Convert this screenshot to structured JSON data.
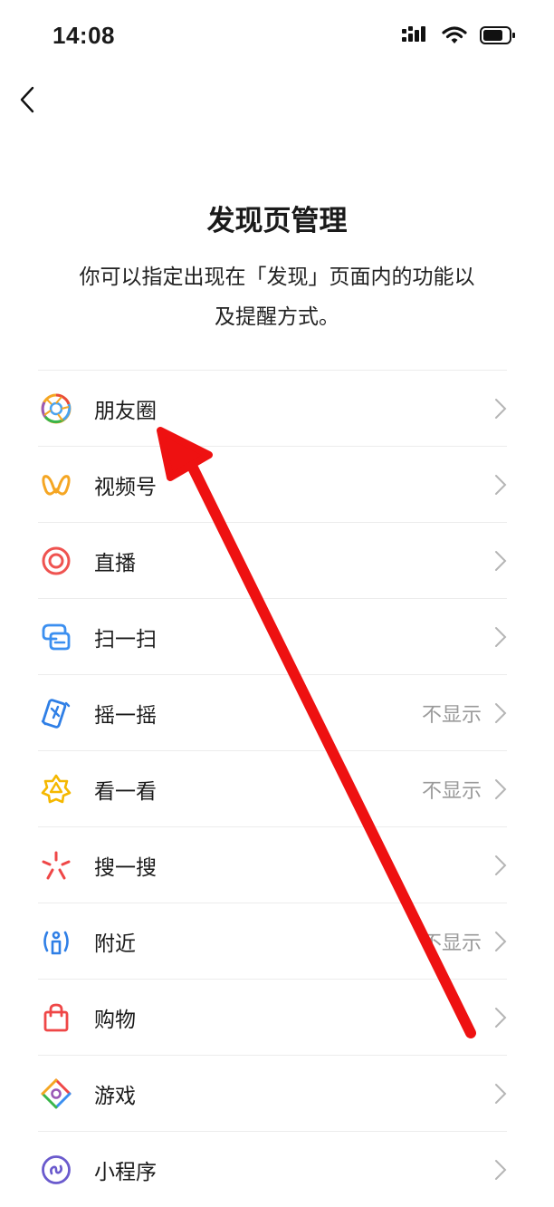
{
  "status_bar": {
    "time": "14:08"
  },
  "header": {
    "title": "发现页管理",
    "description_line1": "你可以指定出现在「发现」页面内的功能以",
    "description_line2": "及提醒方式。"
  },
  "items": [
    {
      "label": "朋友圈",
      "icon": "moments-icon",
      "status": ""
    },
    {
      "label": "视频号",
      "icon": "channels-icon",
      "status": ""
    },
    {
      "label": "直播",
      "icon": "live-icon",
      "status": ""
    },
    {
      "label": "扫一扫",
      "icon": "scan-icon",
      "status": ""
    },
    {
      "label": "摇一摇",
      "icon": "shake-icon",
      "status": "不显示"
    },
    {
      "label": "看一看",
      "icon": "top-stories-icon",
      "status": "不显示"
    },
    {
      "label": "搜一搜",
      "icon": "search-icon",
      "status": ""
    },
    {
      "label": "附近",
      "icon": "nearby-icon",
      "status": "不显示"
    },
    {
      "label": "购物",
      "icon": "shopping-bag-icon",
      "status": ""
    },
    {
      "label": "游戏",
      "icon": "games-icon",
      "status": ""
    },
    {
      "label": "小程序",
      "icon": "mini-programs-icon",
      "status": ""
    }
  ],
  "colors": {
    "annotation_arrow": "#ee1111",
    "status_text": "#9a9a9a",
    "divider": "#ececec"
  }
}
